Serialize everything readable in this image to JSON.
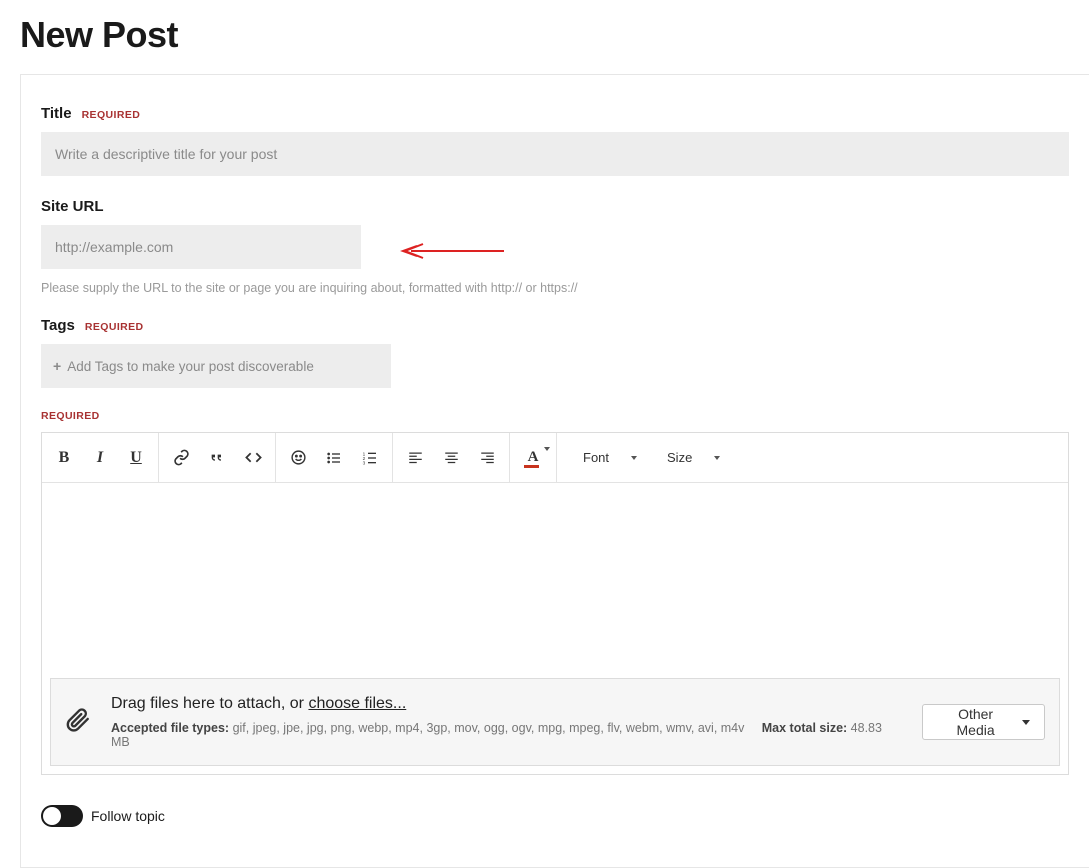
{
  "page": {
    "heading": "New Post"
  },
  "labels": {
    "required": "REQUIRED"
  },
  "fields": {
    "title": {
      "label": "Title",
      "placeholder": "Write a descriptive title for your post",
      "value": ""
    },
    "site_url": {
      "label": "Site URL",
      "placeholder": "http://example.com",
      "value": "",
      "helper": "Please supply the URL to the site or page you are inquiring about, formatted with http:// or https://"
    },
    "tags": {
      "label": "Tags",
      "placeholder": "Add Tags to make your post discoverable"
    }
  },
  "editor": {
    "font_dropdown": "Font",
    "size_dropdown": "Size"
  },
  "attach": {
    "drag_text": "Drag files here to attach, or ",
    "choose_text": "choose files...",
    "accepted_label": "Accepted file types:",
    "accepted_values": " gif, jpeg, jpe, jpg, png, webp, mp4, 3gp, mov, ogg, ogv, mpg, mpeg, flv, webm, wmv, avi, m4v",
    "max_label": "Max total size:",
    "max_value": " 48.83 MB",
    "other_media_label": "Other Media"
  },
  "follow": {
    "label": "Follow topic"
  },
  "annotation": {
    "arrow_color": "#d22"
  }
}
